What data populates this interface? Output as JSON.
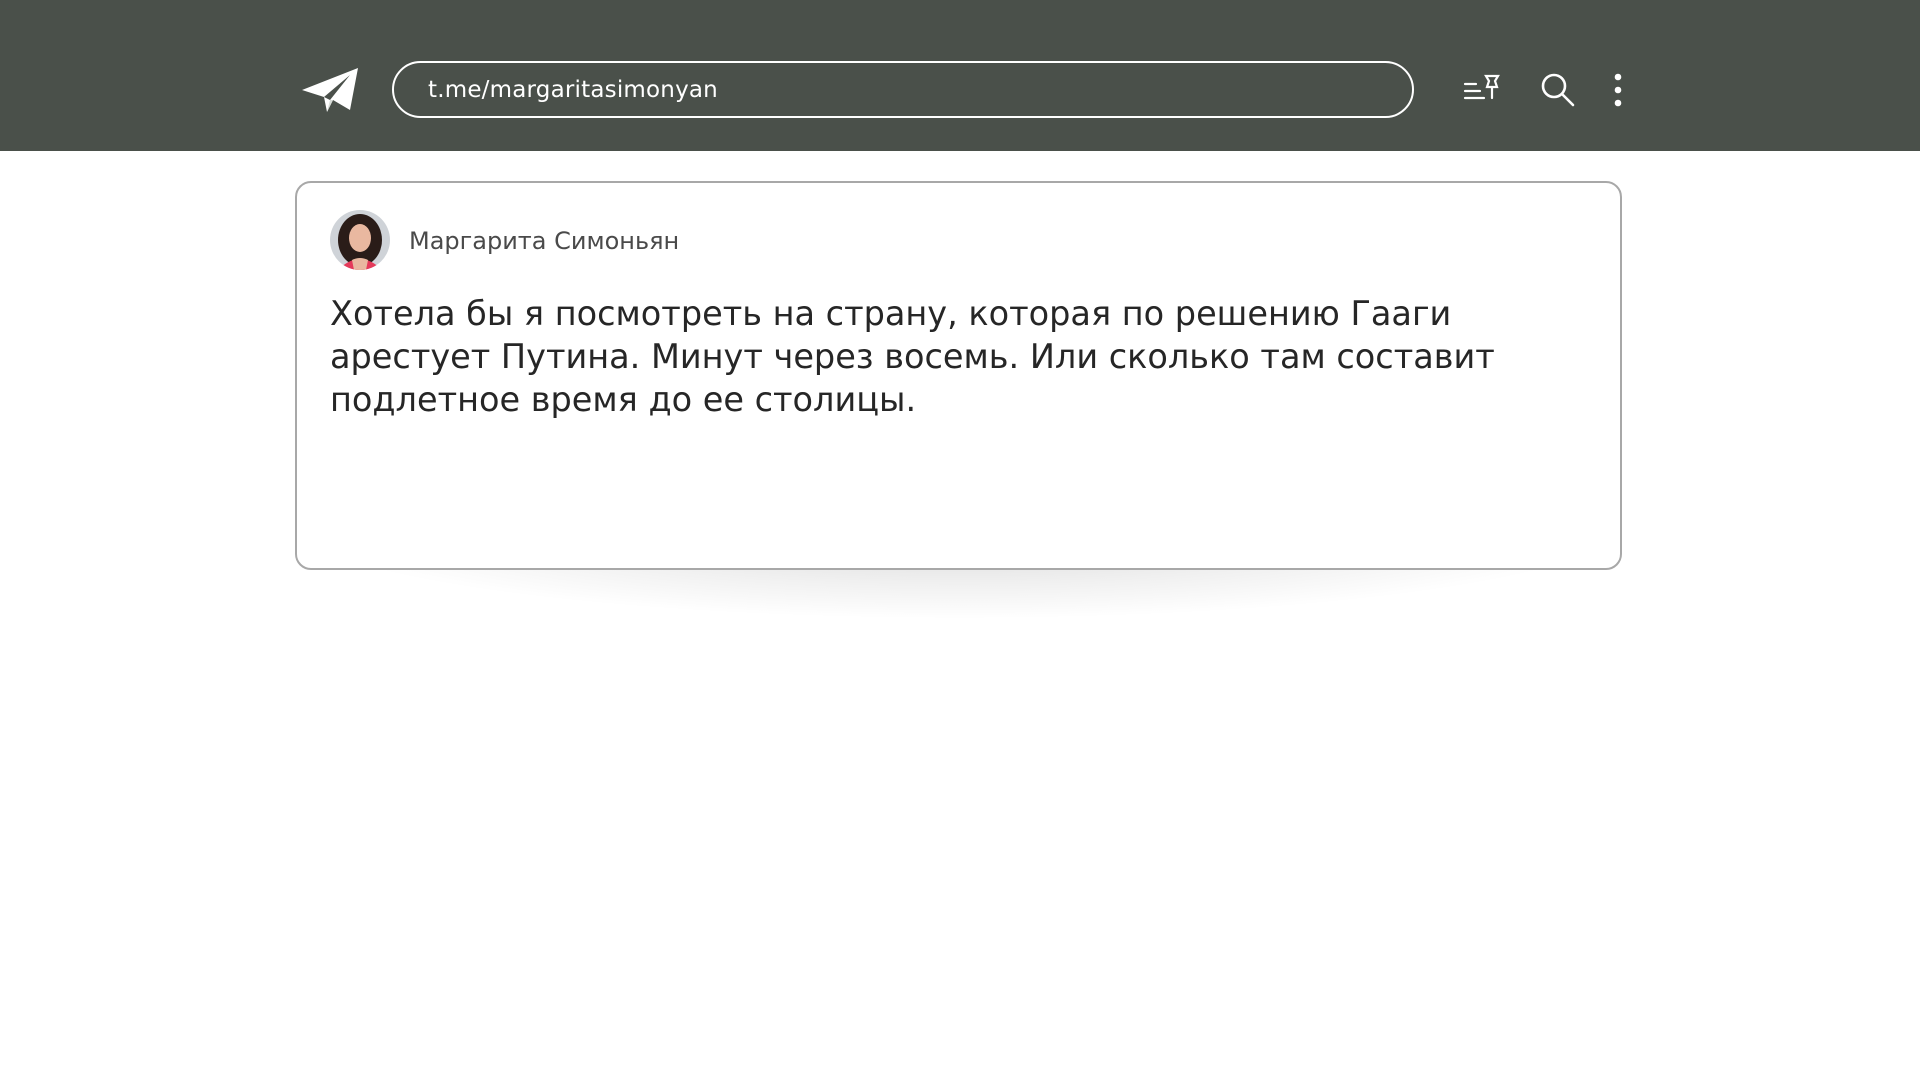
{
  "header": {
    "logo_icon": "telegram-paper-plane-icon",
    "url": "t.me/margaritasimonyan",
    "icons": [
      "pinned-list-icon",
      "search-icon",
      "more-vertical-icon"
    ],
    "background_color": "#4a504a"
  },
  "post": {
    "author": "Маргарита Симоньян",
    "avatar_icon": "author-avatar",
    "text": "Хотела бы я посмотреть на страну, которая по решению Гааги арестует Путина. Минут через восемь. Или сколько там составит подлетное время до ее столицы."
  }
}
